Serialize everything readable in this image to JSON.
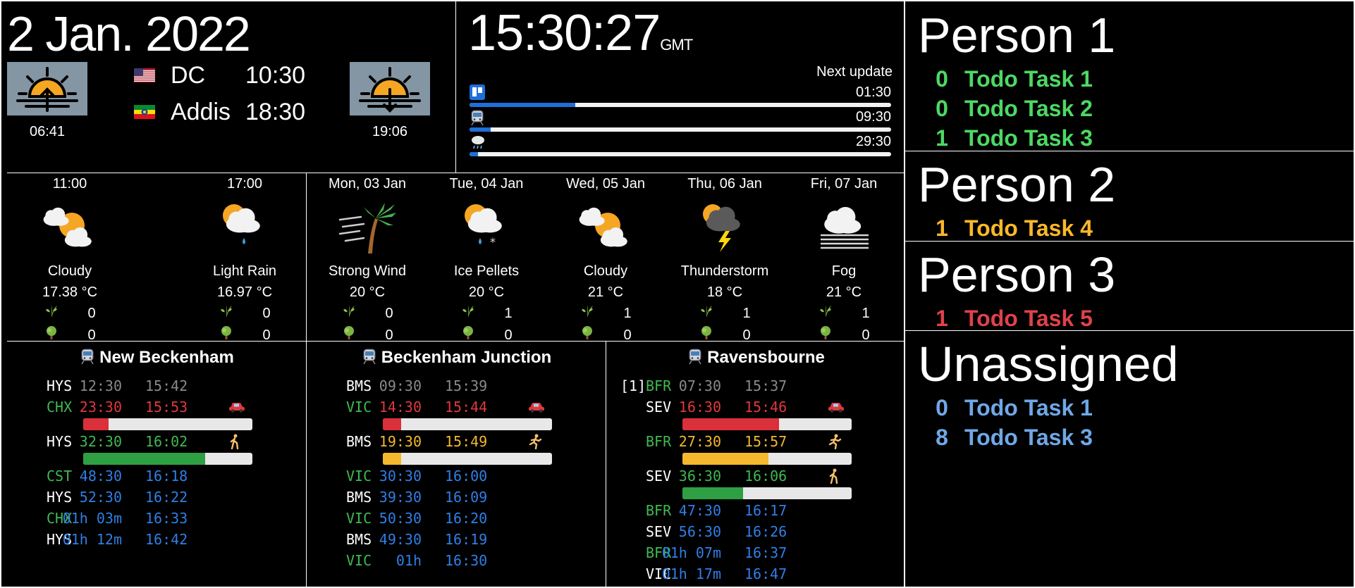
{
  "date": "2 Jan. 2022",
  "sun": {
    "sunrise": "06:41",
    "sunset": "19:06"
  },
  "timezones": [
    {
      "flag_icon": "us-flag-icon",
      "city": "DC",
      "time": "10:30"
    },
    {
      "flag_icon": "ethiopia-flag-icon",
      "city": "Addis",
      "time": "18:30"
    }
  ],
  "clock": {
    "time": "15:30:27",
    "zone": "GMT"
  },
  "updates": {
    "label": "Next update",
    "items": [
      {
        "icon": "trello-icon",
        "time": "01:30",
        "progress": 0.25
      },
      {
        "icon": "train-icon",
        "time": "09:30",
        "progress": 0.05
      },
      {
        "icon": "weather-icon",
        "time": "29:30",
        "progress": 0.02
      }
    ]
  },
  "weather_today": [
    {
      "time": "11:00",
      "icon": "partly-cloudy-icon",
      "desc": "Cloudy",
      "temp": "17.38 °C",
      "grass": "0",
      "tree": "0"
    },
    {
      "time": "17:00",
      "icon": "light-rain-icon",
      "desc": "Light Rain",
      "temp": "16.97 °C",
      "grass": "0",
      "tree": "0"
    }
  ],
  "weather_week": [
    {
      "day": "Mon, 03 Jan",
      "icon": "strong-wind-icon",
      "desc": "Strong Wind",
      "temp": "20 °C",
      "grass": "0",
      "tree": "0"
    },
    {
      "day": "Tue, 04 Jan",
      "icon": "ice-pellets-icon",
      "desc": "Ice Pellets",
      "temp": "20 °C",
      "grass": "1",
      "tree": "0"
    },
    {
      "day": "Wed, 05 Jan",
      "icon": "partly-cloudy-icon",
      "desc": "Cloudy",
      "temp": "21 °C",
      "grass": "1",
      "tree": "0"
    },
    {
      "day": "Thu, 06 Jan",
      "icon": "thunderstorm-icon",
      "desc": "Thunderstorm",
      "temp": "18 °C",
      "grass": "1",
      "tree": "0"
    },
    {
      "day": "Fri, 07 Jan",
      "icon": "fog-icon",
      "desc": "Fog",
      "temp": "21 °C",
      "grass": "1",
      "tree": "0"
    }
  ],
  "stations": [
    {
      "name": "New Beckenham",
      "rows": [
        {
          "platform": "",
          "dest": "HYS",
          "dest_color": "#ffffff",
          "wait": "12:30",
          "dep": "15:42",
          "color": "#8a8a8a",
          "icon": ""
        },
        {
          "platform": "",
          "dest": "CHX",
          "dest_color": "#3fb950",
          "wait": "23:30",
          "dep": "15:53",
          "color": "#e0383e",
          "icon": "car-icon",
          "bar": {
            "progress": 0.15,
            "color": "#d9303b"
          }
        },
        {
          "platform": "",
          "dest": "HYS",
          "dest_color": "#ffffff",
          "wait": "32:30",
          "dep": "16:02",
          "color": "#3fb950",
          "icon": "walk-icon",
          "bar": {
            "progress": 0.72,
            "color": "#2ea043"
          }
        },
        {
          "platform": "",
          "dest": "CST",
          "dest_color": "#3fb950",
          "wait": "48:30",
          "dep": "16:18",
          "color": "#2f7fe6",
          "icon": ""
        },
        {
          "platform": "",
          "dest": "HYS",
          "dest_color": "#ffffff",
          "wait": "52:30",
          "dep": "16:22",
          "color": "#2f7fe6",
          "icon": ""
        },
        {
          "platform": "",
          "dest": "CHX",
          "dest_color": "#3fb950",
          "wait": "01h 03m",
          "dep": "16:33",
          "color": "#2f7fe6",
          "icon": ""
        },
        {
          "platform": "",
          "dest": "HYS",
          "dest_color": "#ffffff",
          "wait": "01h 12m",
          "dep": "16:42",
          "color": "#2f7fe6",
          "icon": ""
        }
      ]
    },
    {
      "name": "Beckenham Junction",
      "rows": [
        {
          "platform": "",
          "dest": "BMS",
          "dest_color": "#ffffff",
          "wait": "09:30",
          "dep": "15:39",
          "color": "#8a8a8a",
          "icon": ""
        },
        {
          "platform": "",
          "dest": "VIC",
          "dest_color": "#3fb950",
          "wait": "14:30",
          "dep": "15:44",
          "color": "#e0383e",
          "icon": "car-icon",
          "bar": {
            "progress": 0.11,
            "color": "#d9303b"
          }
        },
        {
          "platform": "",
          "dest": "BMS",
          "dest_color": "#ffffff",
          "wait": "19:30",
          "dep": "15:49",
          "color": "#f5b82e",
          "icon": "run-icon",
          "bar": {
            "progress": 0.11,
            "color": "#f5b82e"
          }
        },
        {
          "platform": "",
          "dest": "VIC",
          "dest_color": "#3fb950",
          "wait": "30:30",
          "dep": "16:00",
          "color": "#2f7fe6",
          "icon": ""
        },
        {
          "platform": "",
          "dest": "BMS",
          "dest_color": "#ffffff",
          "wait": "39:30",
          "dep": "16:09",
          "color": "#2f7fe6",
          "icon": ""
        },
        {
          "platform": "",
          "dest": "VIC",
          "dest_color": "#3fb950",
          "wait": "50:30",
          "dep": "16:20",
          "color": "#2f7fe6",
          "icon": ""
        },
        {
          "platform": "",
          "dest": "BMS",
          "dest_color": "#ffffff",
          "wait": "49:30",
          "dep": "16:19",
          "color": "#2f7fe6",
          "icon": ""
        },
        {
          "platform": "",
          "dest": "VIC",
          "dest_color": "#3fb950",
          "wait": "01h",
          "dep": "16:30",
          "color": "#2f7fe6",
          "icon": ""
        }
      ]
    },
    {
      "name": "Ravensbourne",
      "rows": [
        {
          "platform": "[1]",
          "dest": "BFR",
          "dest_color": "#3fb950",
          "wait": "07:30",
          "dep": "15:37",
          "color": "#8a8a8a",
          "icon": ""
        },
        {
          "platform": "",
          "dest": "SEV",
          "dest_color": "#ffffff",
          "wait": "16:30",
          "dep": "15:46",
          "color": "#e0383e",
          "icon": "car-icon",
          "bar": {
            "progress": 0.57,
            "color": "#d9303b"
          }
        },
        {
          "platform": "",
          "dest": "BFR",
          "dest_color": "#3fb950",
          "wait": "27:30",
          "dep": "15:57",
          "color": "#f5b82e",
          "icon": "run-icon",
          "bar": {
            "progress": 0.51,
            "color": "#f5b82e"
          }
        },
        {
          "platform": "",
          "dest": "SEV",
          "dest_color": "#ffffff",
          "wait": "36:30",
          "dep": "16:06",
          "color": "#3fb950",
          "icon": "walk-icon",
          "bar": {
            "progress": 0.36,
            "color": "#2ea043"
          }
        },
        {
          "platform": "",
          "dest": "BFR",
          "dest_color": "#3fb950",
          "wait": "47:30",
          "dep": "16:17",
          "color": "#2f7fe6",
          "icon": ""
        },
        {
          "platform": "",
          "dest": "SEV",
          "dest_color": "#ffffff",
          "wait": "56:30",
          "dep": "16:26",
          "color": "#2f7fe6",
          "icon": ""
        },
        {
          "platform": "",
          "dest": "BFR",
          "dest_color": "#3fb950",
          "wait": "01h 07m",
          "dep": "16:37",
          "color": "#2f7fe6",
          "icon": ""
        },
        {
          "platform": "",
          "dest": "VIC",
          "dest_color": "#ffffff",
          "wait": "01h 17m",
          "dep": "16:47",
          "color": "#2f7fe6",
          "icon": ""
        }
      ]
    }
  ],
  "todo": [
    {
      "person": "Person 1",
      "color": "#4cd964",
      "tasks": [
        {
          "count": "0",
          "name": "Todo Task 1"
        },
        {
          "count": "0",
          "name": "Todo Task 2"
        },
        {
          "count": "1",
          "name": "Todo Task 3"
        }
      ]
    },
    {
      "person": "Person 2",
      "color": "#fbb829",
      "tasks": [
        {
          "count": "1",
          "name": "Todo Task 4"
        }
      ]
    },
    {
      "person": "Person 3",
      "color": "#e0424a",
      "tasks": [
        {
          "count": "1",
          "name": "Todo Task 5"
        }
      ]
    },
    {
      "person": "Unassigned",
      "color": "#6fa8e8",
      "tasks": [
        {
          "count": "0",
          "name": "Todo Task 1"
        },
        {
          "count": "8",
          "name": "Todo Task 3"
        }
      ]
    }
  ]
}
